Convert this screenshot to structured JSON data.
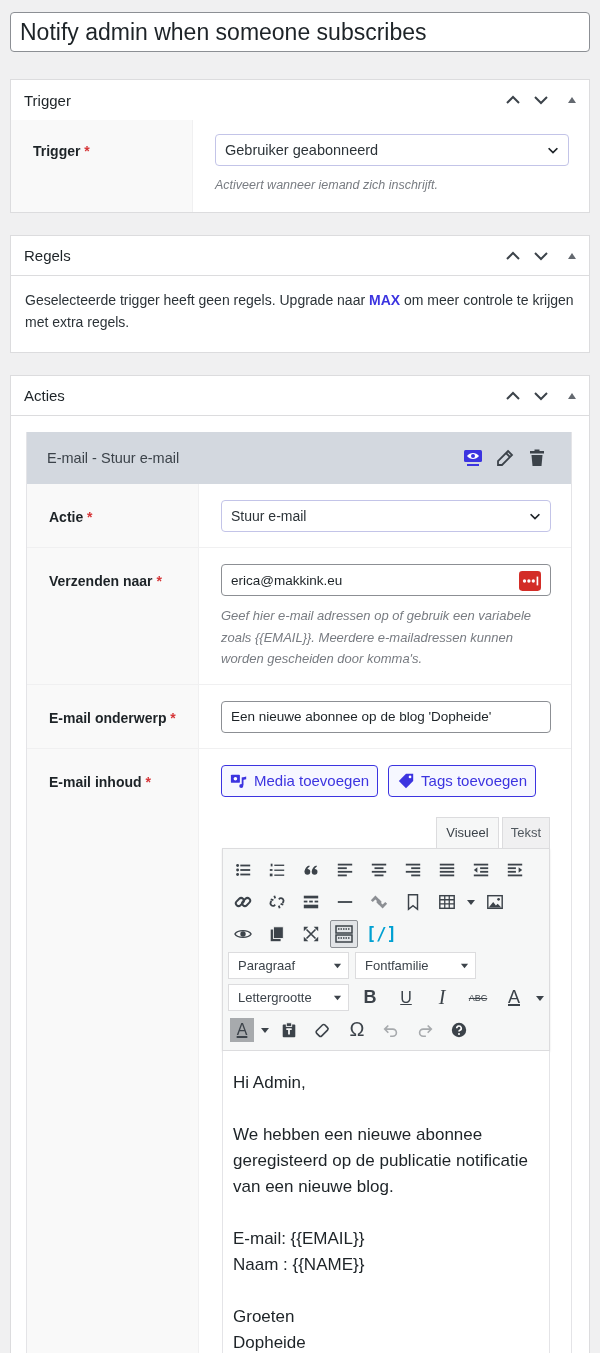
{
  "title": {
    "value": "Notify admin when someone subscribes"
  },
  "trigger_panel": {
    "title": "Trigger",
    "expanded": true,
    "field": {
      "label": "Trigger",
      "required_mark": "*",
      "value": "Gebruiker geabonneerd",
      "hint": "Activeert wanneer iemand zich inschrijft."
    }
  },
  "rules_panel": {
    "title": "Regels",
    "expanded": true,
    "text": "Geselecteerde trigger heeft geen regels. Upgrade naar **MAX** om meer controle te krijgen met extra regels."
  },
  "actions_panel": {
    "title": "Acties",
    "expanded": true,
    "action": {
      "title": "E-mail - Stuur e-mail",
      "fields": [
        {
          "kind": "select",
          "label": "Actie",
          "required_mark": "*",
          "value": "Stuur e-mail"
        },
        {
          "kind": "email",
          "label": "Verzenden naar",
          "required_mark": "*",
          "value": "erica@makkink.eu",
          "hint": "Geef hier e-mail adressen op of gebruik een variabele zoals {{EMAIL}}. Meerdere e-mailadressen kunnen worden gescheiden door komma's."
        },
        {
          "kind": "text",
          "label": "E-mail onderwerp",
          "required_mark": "*",
          "value": "Een nieuwe abonnee op de blog 'Dopheide'"
        },
        {
          "kind": "editor",
          "label": "E-mail inhoud",
          "required_mark": "*"
        }
      ],
      "editor": {
        "buttons": [
          "Media toevoegen",
          "Tags toevoegen"
        ],
        "tabs": [
          {
            "label": "Visueel",
            "selected": true
          },
          {
            "label": "Tekst",
            "selected": false
          }
        ],
        "shortcode_button": "[/]",
        "toolbar_toggle": {
          "pressed": true
        },
        "selects": [
          "Paragraaf",
          "Fontfamilie",
          "Lettergrootte"
        ],
        "format_buttons": [
          "B",
          "U",
          "I",
          "ABC",
          "A"
        ],
        "highlight_button": "A",
        "special_char_button": "Ω",
        "undo": {
          "disabled": true
        },
        "redo": {
          "disabled": true
        },
        "content": [
          [
            "Hi Admin,"
          ],
          [
            "We hebben een nieuwe abonnee geregisteerd op de publicatie notificatie van een nieuwe blog."
          ],
          [
            "E-mail: {{EMAIL}}",
            "Naam : {{NAME}}"
          ],
          [
            "Groeten",
            "Dopheide"
          ]
        ]
      }
    }
  }
}
